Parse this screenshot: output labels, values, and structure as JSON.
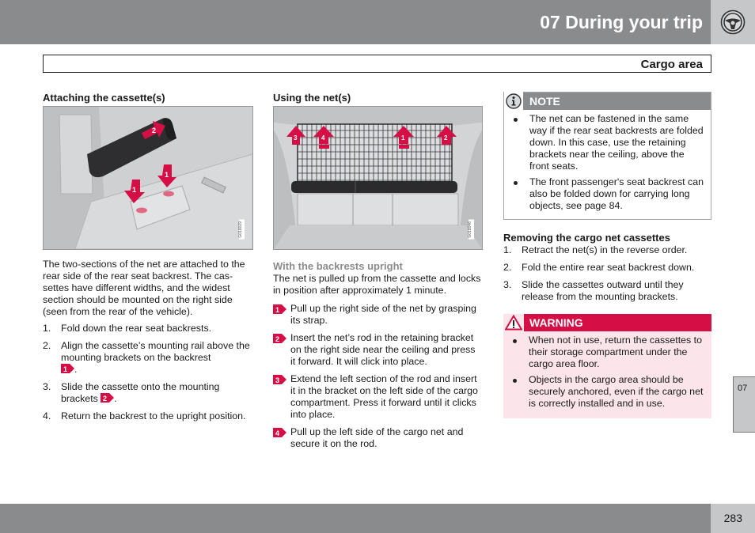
{
  "header": {
    "title": "07 During your trip",
    "icon": "steering-wheel-icon"
  },
  "section": {
    "title": "Cargo area"
  },
  "col1": {
    "heading": "Attaching the cassette(s)",
    "figure": {
      "code": "G018029",
      "callouts": [
        "2",
        "1",
        "1"
      ]
    },
    "intro": "The two-sections of the net are attached to the rear side of the rear seat backrest. The cas-settes have different widths, and the widest section should be mounted on the right side (seen from the rear of the vehicle).",
    "steps": [
      {
        "num": "1.",
        "text": "Fold down the rear seat backrests.",
        "ref": ""
      },
      {
        "num": "2.",
        "text": "Align the cassette’s mounting rail above the mounting brackets on the backrest",
        "ref": "1"
      },
      {
        "num": "3.",
        "text": "Slide the cassette onto the mounting brackets",
        "ref": "2"
      },
      {
        "num": "4.",
        "text": "Return the backrest to the upright position.",
        "ref": ""
      }
    ]
  },
  "col2": {
    "heading": "Using the net(s)",
    "figure": {
      "code": "G018046",
      "callouts": [
        "3",
        "4",
        "1",
        "2"
      ]
    },
    "subheading": "With the backrests upright",
    "intro": "The net is pulled up from the cassette and locks in position after approximately 1 minute.",
    "steps": [
      {
        "badge": "1",
        "text": "Pull up the right side of the net by grasping its strap."
      },
      {
        "badge": "2",
        "text": "Insert the net’s rod in the retaining bracket on the right side near the ceiling and press it forward. It will click into place."
      },
      {
        "badge": "3",
        "text": "Extend the left section of the rod and insert it in the bracket on the left side of the cargo compartment. Press it forward until it clicks into place."
      },
      {
        "badge": "4",
        "text": "Pull up the left side of the cargo net and secure it on the rod."
      }
    ]
  },
  "col3": {
    "note": {
      "label": "NOTE",
      "items": [
        "The net can be fastened in the same way if the rear seat backrests are folded down. In this case, use the retaining brackets near the ceiling, above the front seats.",
        "The front passenger's seat backrest can also be folded down for carrying long objects, see page 84."
      ]
    },
    "removing": {
      "heading": "Removing the cargo net cassettes",
      "steps": [
        {
          "num": "1.",
          "text": "Retract the net(s) in the reverse order."
        },
        {
          "num": "2.",
          "text": "Fold the entire rear seat backrest down."
        },
        {
          "num": "3.",
          "text": "Slide the cassettes outward until they release from the mounting brackets."
        }
      ]
    },
    "warning": {
      "label": "WARNING",
      "items": [
        "When not in use, return the cassettes to their storage compartment under the cargo area floor.",
        "Objects in the cargo area should be securely anchored, even if the cargo net is correctly installed and in use."
      ]
    }
  },
  "side_tab": {
    "label": "07"
  },
  "footer": {
    "page_number": "283"
  },
  "colors": {
    "header_gray": "#8a8b8d",
    "light_gray": "#c6c7c9",
    "accent_red": "#d50f45",
    "warning_bg": "#fbe5ea"
  }
}
